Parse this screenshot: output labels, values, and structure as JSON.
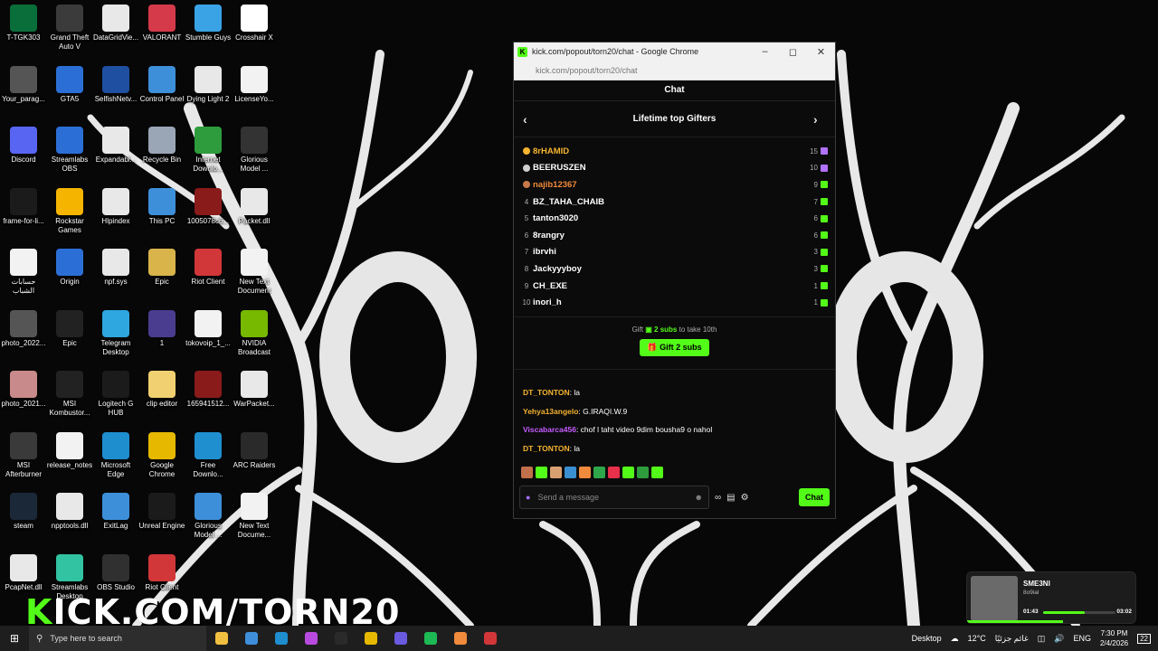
{
  "desktop": {
    "icons": [
      {
        "label": "T-TGK303",
        "color": "#0a6e3a"
      },
      {
        "label": "Grand Theft Auto V",
        "color": "#3b3b3b"
      },
      {
        "label": "DataGridVie...",
        "color": "#e8e8e8"
      },
      {
        "label": "VALORANT",
        "color": "#d43a4a"
      },
      {
        "label": "Stumble Guys",
        "color": "#3aa3e6"
      },
      {
        "label": "Crosshair X",
        "color": "#ffffff"
      },
      {
        "label": "Your_parag...",
        "color": "#555555"
      },
      {
        "label": "GTA5",
        "color": "#2b6fd6"
      },
      {
        "label": "SelfishNetv...",
        "color": "#1f4fa0"
      },
      {
        "label": "Control Panel",
        "color": "#3d8fd9"
      },
      {
        "label": "Dying Light 2",
        "color": "#e8e8e8"
      },
      {
        "label": "LicenseYo...",
        "color": "#f2f2f2"
      },
      {
        "label": "Discord",
        "color": "#5865f2"
      },
      {
        "label": "Streamlabs OBS",
        "color": "#2b6fd6"
      },
      {
        "label": "Expandabl...",
        "color": "#e8e8e8"
      },
      {
        "label": "Recycle Bin",
        "color": "#9aa6b5"
      },
      {
        "label": "Internet Downlo...",
        "color": "#2e9c3c"
      },
      {
        "label": "Glorious Model ...",
        "color": "#333333"
      },
      {
        "label": "frame-for-li...",
        "color": "#1b1b1b"
      },
      {
        "label": "Rockstar Games",
        "color": "#f5b400"
      },
      {
        "label": "Hlpindex",
        "color": "#e8e8e8"
      },
      {
        "label": "This PC",
        "color": "#3d8fd9"
      },
      {
        "label": "1005078c6...",
        "color": "#8a1b1b"
      },
      {
        "label": "Packet.dll",
        "color": "#e8e8e8"
      },
      {
        "label": "حسابات الشباب",
        "color": "#f2f2f2"
      },
      {
        "label": "Origin",
        "color": "#2b6fd6"
      },
      {
        "label": "npf.sys",
        "color": "#e8e8e8"
      },
      {
        "label": "Epic",
        "color": "#d8b44a"
      },
      {
        "label": "Riot Client",
        "color": "#d13639"
      },
      {
        "label": "New Text Document",
        "color": "#f2f2f2"
      },
      {
        "label": "photo_2022...",
        "color": "#555555"
      },
      {
        "label": "Epic",
        "color": "#222222"
      },
      {
        "label": "Telegram Desktop",
        "color": "#2ea6e0"
      },
      {
        "label": "1",
        "color": "#4a3d8f"
      },
      {
        "label": "tokovoip_1_...",
        "color": "#f2f2f2"
      },
      {
        "label": "NVIDIA Broadcast",
        "color": "#76b900"
      },
      {
        "label": "photo_2021...",
        "color": "#c88a8a"
      },
      {
        "label": "MSI Kombustor...",
        "color": "#222222"
      },
      {
        "label": "Logitech G HUB",
        "color": "#1b1b1b"
      },
      {
        "label": "clip editor",
        "color": "#f0d070"
      },
      {
        "label": "165941512...",
        "color": "#8a1b1b"
      },
      {
        "label": "WarPacket...",
        "color": "#e8e8e8"
      },
      {
        "label": "MSI Afterburner",
        "color": "#3a3a3a"
      },
      {
        "label": "release_notes",
        "color": "#f2f2f2"
      },
      {
        "label": "Microsoft Edge",
        "color": "#1e8ecf"
      },
      {
        "label": "Google Chrome",
        "color": "#e6b800"
      },
      {
        "label": "Free Downlo...",
        "color": "#1f8fcf"
      },
      {
        "label": "ARC Raiders",
        "color": "#2a2a2a"
      },
      {
        "label": "steam",
        "color": "#1b2838"
      },
      {
        "label": "npptools.dll",
        "color": "#e8e8e8"
      },
      {
        "label": "ExitLag",
        "color": "#3d8fd9"
      },
      {
        "label": "Unreal Engine",
        "color": "#1b1b1b"
      },
      {
        "label": "Glorious Model ...",
        "color": "#3d8fd9"
      },
      {
        "label": "New Text Docume...",
        "color": "#f2f2f2"
      },
      {
        "label": "PcapNet.dll",
        "color": "#e8e8e8"
      },
      {
        "label": "Streamlabs Desktop",
        "color": "#31c3a2"
      },
      {
        "label": "OBS Studio",
        "color": "#303030"
      },
      {
        "label": "Riot Client",
        "color": "#d13639"
      }
    ]
  },
  "window": {
    "title": "kick.com/popout/torn20/chat - Google Chrome",
    "url": "kick.com/popout/torn20/chat",
    "favicon": "K"
  },
  "chat": {
    "header": "Chat",
    "gifters_title": "Lifetime top Gifters",
    "gifters": [
      {
        "rank": "1",
        "name": "8rHAMID",
        "count": "15",
        "name_color": "#f5b430",
        "medal": "#f5b430",
        "gift_color": "#b072ff"
      },
      {
        "rank": "2",
        "name": "BEERUSZEN",
        "count": "10",
        "name_color": "#ffffff",
        "medal": "#cfcfcf",
        "gift_color": "#b072ff"
      },
      {
        "rank": "3",
        "name": "najib12367",
        "count": "9",
        "name_color": "#f08a3c",
        "medal": "#c87a4a",
        "gift_color": "#53fc18"
      },
      {
        "rank": "4",
        "name": "BZ_TAHA_CHAIB",
        "count": "7",
        "name_color": "#ffffff",
        "medal": "",
        "gift_color": "#53fc18"
      },
      {
        "rank": "5",
        "name": "tanton3020",
        "count": "6",
        "name_color": "#ffffff",
        "medal": "",
        "gift_color": "#53fc18"
      },
      {
        "rank": "6",
        "name": "8rangry",
        "count": "6",
        "name_color": "#ffffff",
        "medal": "",
        "gift_color": "#53fc18"
      },
      {
        "rank": "7",
        "name": "ibrvhi",
        "count": "3",
        "name_color": "#ffffff",
        "medal": "",
        "gift_color": "#53fc18"
      },
      {
        "rank": "8",
        "name": "Jackyyyboy",
        "count": "3",
        "name_color": "#ffffff",
        "medal": "",
        "gift_color": "#53fc18"
      },
      {
        "rank": "9",
        "name": "CH_EXE",
        "count": "1",
        "name_color": "#ffffff",
        "medal": "",
        "gift_color": "#53fc18"
      },
      {
        "rank": "10",
        "name": "inori_h",
        "count": "1",
        "name_color": "#ffffff",
        "medal": "",
        "gift_color": "#53fc18"
      }
    ],
    "gift_note_prefix": "Gift",
    "gift_note_subs": "2 subs",
    "gift_note_suffix": "to take 10th",
    "gift_button": "Gift 2 subs",
    "messages": [
      {
        "user": "DT_TONTON",
        "text": ": la",
        "color": "#f5b430"
      },
      {
        "user": "Yehya13angelo",
        "text": ": G.IRAQI.W.9",
        "color": "#f5b430"
      },
      {
        "user": "Viscabarca456",
        "text": ": chof l taht video 9dim bousha9 o nahol",
        "color": "#c65cff"
      },
      {
        "user": "DT_TONTON",
        "text": ": la",
        "color": "#f5b430"
      }
    ],
    "emote_colors": [
      "#c0704a",
      "#53fc18",
      "#d8a070",
      "#3a8fd0",
      "#f08a3c",
      "#2ea64a",
      "#e8304a",
      "#53fc18",
      "#2e9c3c",
      "#53fc18"
    ],
    "input_placeholder": "Send a message",
    "send_label": "Chat"
  },
  "brand_overlay": {
    "k": "K",
    "rest": "ICK.COM/TORN20"
  },
  "media": {
    "song": "SME3NI",
    "artist": "8o9ial",
    "elapsed": "01:43",
    "duration": "03:02",
    "progress": 0.57
  },
  "taskbar": {
    "search_placeholder": "Type here to search",
    "desktop_label": "Desktop",
    "weather": "12°C",
    "weather_text": "غائم جزئيًا",
    "lang": "ENG",
    "time": "7:30 PM",
    "date": "2/4/2026",
    "notif_count": "22",
    "apps": [
      "#f0c040",
      "#3d8fd9",
      "#1e8ecf",
      "#b84adf",
      "#2a2a2a",
      "#e6b800",
      "#6a5adf",
      "#1db954",
      "#f08a3c",
      "#d13639"
    ]
  }
}
